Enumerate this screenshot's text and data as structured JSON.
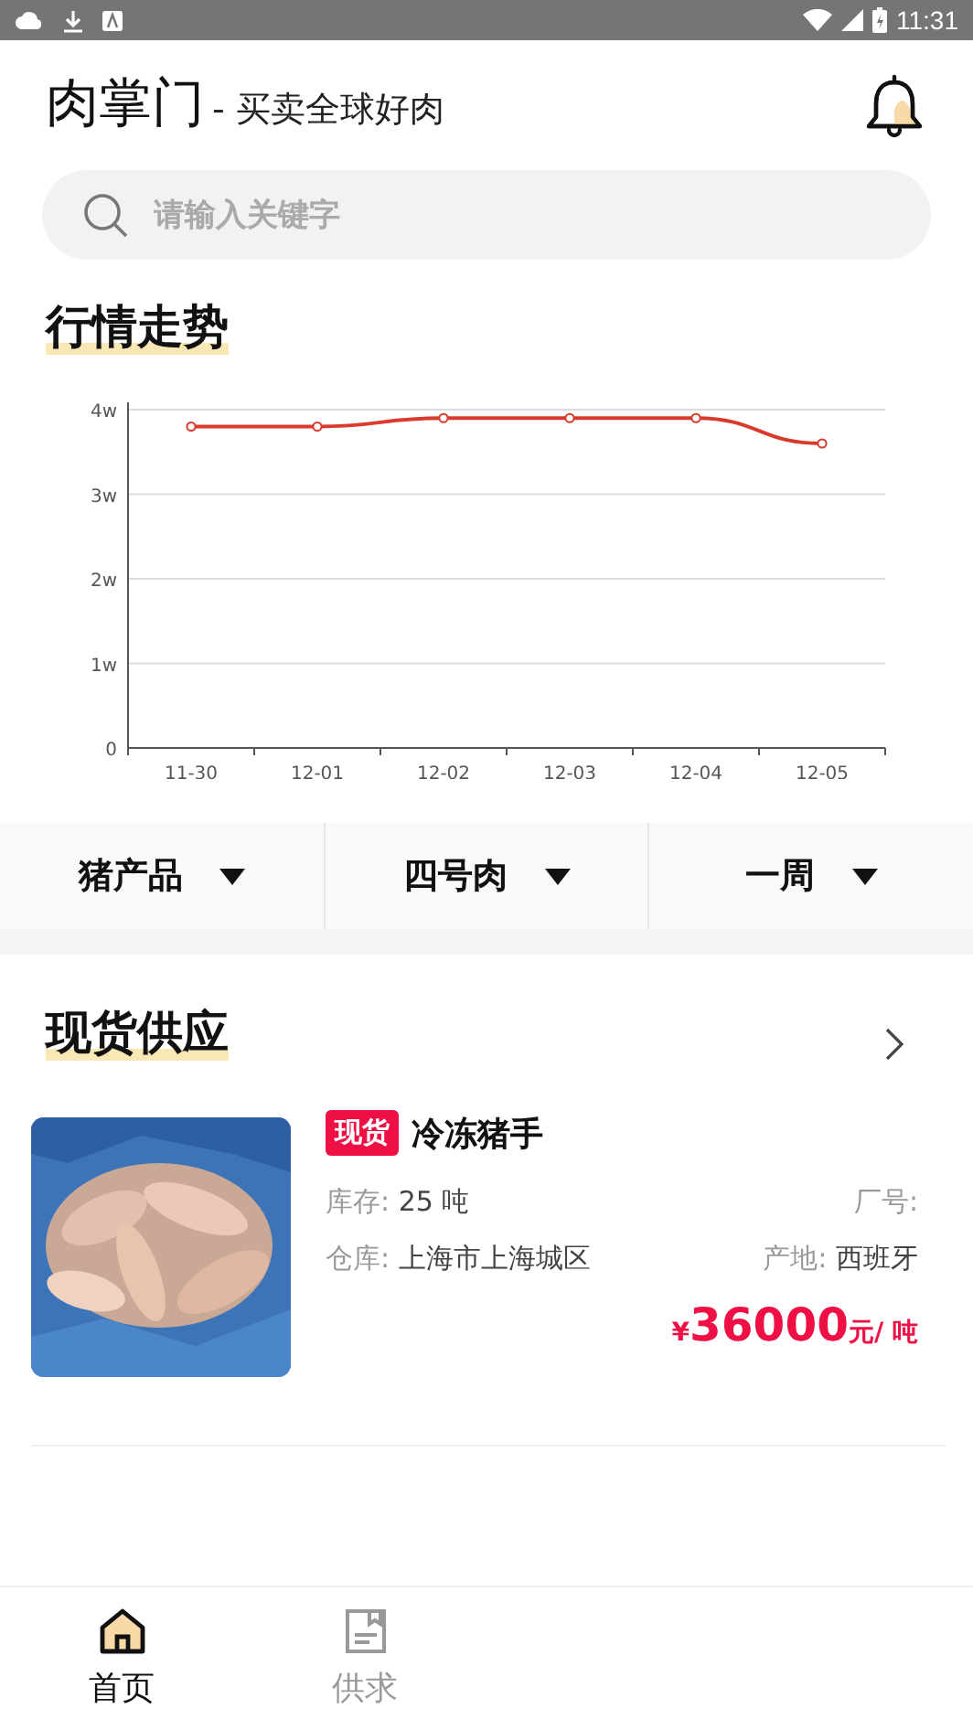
{
  "status_bar": {
    "time": "11:31"
  },
  "header": {
    "title": "肉掌门",
    "slogan": "- 买卖全球好肉"
  },
  "search": {
    "placeholder": "请输入关键字"
  },
  "trend": {
    "title": "行情走势",
    "chart_data": {
      "type": "line",
      "categories": [
        "11-30",
        "12-01",
        "12-02",
        "12-03",
        "12-04",
        "12-05"
      ],
      "grid": true,
      "series": [
        {
          "color": "#d93a2b",
          "marker": true,
          "values": [
            3.8,
            3.8,
            3.9,
            3.9,
            3.9,
            3.6
          ]
        }
      ],
      "ylim": [
        0,
        4
      ],
      "yticks": [
        {
          "value": 0,
          "label": "0"
        },
        {
          "value": 1,
          "label": "1w"
        },
        {
          "value": 2,
          "label": "2w"
        },
        {
          "value": 3,
          "label": "3w"
        },
        {
          "value": 4,
          "label": "4w"
        }
      ]
    }
  },
  "filters": [
    {
      "label": "猪产品"
    },
    {
      "label": "四号肉"
    },
    {
      "label": "一周"
    }
  ],
  "supply": {
    "title": "现货供应",
    "products": [
      {
        "tag": "现货",
        "name": "冷冻猪手",
        "stock_label": "库存:",
        "stock": "25 吨",
        "factory_label": "厂号:",
        "warehouse_label": "仓库:",
        "warehouse": "上海市上海城区",
        "origin_label": "产地:",
        "origin": "西班牙",
        "currency": "¥",
        "price": "36000",
        "unit": "元/ 吨"
      }
    ]
  },
  "bottom_nav": [
    {
      "label": "首页",
      "selected": true
    },
    {
      "label": "供求",
      "selected": false
    }
  ]
}
